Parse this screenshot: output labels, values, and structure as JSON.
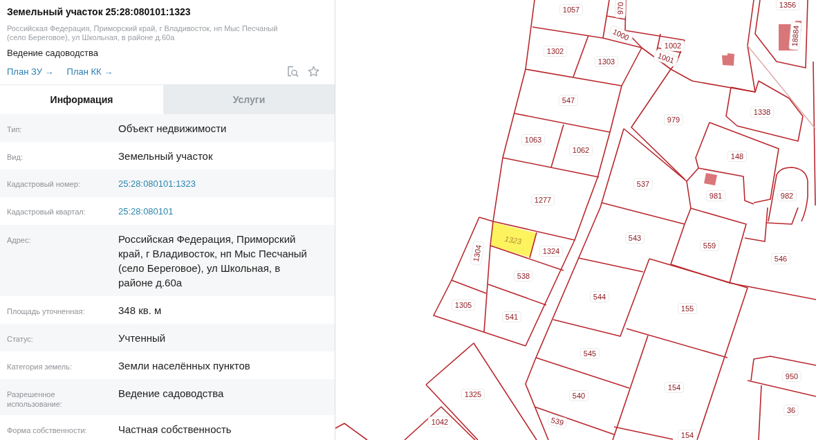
{
  "card": {
    "title": "Земельный участок 25:28:080101:1323",
    "address": "Российская Федерация, Приморский край, г Владивосток, нп Мыс Песчаный (село Береговое), ул Школьная, в районе д.60а",
    "usage": "Ведение садоводства",
    "links": [
      "План ЗУ →",
      "План КК →"
    ]
  },
  "tabs": [
    {
      "label": "Информация",
      "selected": true
    },
    {
      "label": "Услуги",
      "selected": false
    }
  ],
  "properties": [
    {
      "label": "Тип:",
      "value": "Объект недвижимости",
      "kind": "text"
    },
    {
      "label": "Вид:",
      "value": "Земельный участок",
      "kind": "text"
    },
    {
      "label": "Кадастровый номер:",
      "value": "25:28:080101:1323",
      "kind": "link"
    },
    {
      "label": "Кадастровый квартал:",
      "value": "25:28:080101",
      "kind": "link"
    },
    {
      "label": "Адрес:",
      "value": "Российская Федерация, Приморский край, г Владивосток, нп Мыс Песчаный (село Береговое), ул Школьная, в районе д.60а",
      "kind": "text"
    },
    {
      "label": "Площадь уточненная:",
      "value": "348 кв. м",
      "kind": "text"
    },
    {
      "label": "Статус:",
      "value": "Учтенный",
      "kind": "text"
    },
    {
      "label": "Категория земель:",
      "value": "Земли населённых пунктов",
      "kind": "text"
    },
    {
      "label": "Разрешенное использование:",
      "value": "Ведение садоводства",
      "kind": "text"
    },
    {
      "label": "Форма собственности:",
      "value": "Частная собственность",
      "kind": "text"
    }
  ],
  "map": {
    "parcels": [
      {
        "label": "1057",
        "selected": false
      },
      {
        "label": "970",
        "selected": false
      },
      {
        "label": "1000",
        "selected": false
      },
      {
        "label": "1002",
        "selected": false
      },
      {
        "label": "1001",
        "selected": false
      },
      {
        "label": "1356",
        "selected": false
      },
      {
        "label": "18884",
        "selected": false
      },
      {
        "label": "1302",
        "selected": false
      },
      {
        "label": "1303",
        "selected": false
      },
      {
        "label": "547",
        "selected": false
      },
      {
        "label": "979",
        "selected": false
      },
      {
        "label": "1338",
        "selected": false
      },
      {
        "label": "1063",
        "selected": false
      },
      {
        "label": "1062",
        "selected": false
      },
      {
        "label": "148",
        "selected": false
      },
      {
        "label": "537",
        "selected": false
      },
      {
        "label": "981",
        "selected": false
      },
      {
        "label": "982",
        "selected": false
      },
      {
        "label": "1277",
        "selected": false
      },
      {
        "label": "1323",
        "selected": true
      },
      {
        "label": "1304",
        "selected": false
      },
      {
        "label": "1324",
        "selected": false
      },
      {
        "label": "543",
        "selected": false
      },
      {
        "label": "559",
        "selected": false
      },
      {
        "label": "546",
        "selected": false
      },
      {
        "label": "538",
        "selected": false
      },
      {
        "label": "1305",
        "selected": false
      },
      {
        "label": "541",
        "selected": false
      },
      {
        "label": "544",
        "selected": false
      },
      {
        "label": "155",
        "selected": false
      },
      {
        "label": "545",
        "selected": false
      },
      {
        "label": "950",
        "selected": false
      },
      {
        "label": "1325",
        "selected": false
      },
      {
        "label": "540",
        "selected": false
      },
      {
        "label": "154",
        "selected": false
      },
      {
        "label": "36",
        "selected": false
      },
      {
        "label": "1042",
        "selected": false
      },
      {
        "label": "539",
        "selected": false
      },
      {
        "label": "154",
        "selected": false
      }
    ]
  }
}
